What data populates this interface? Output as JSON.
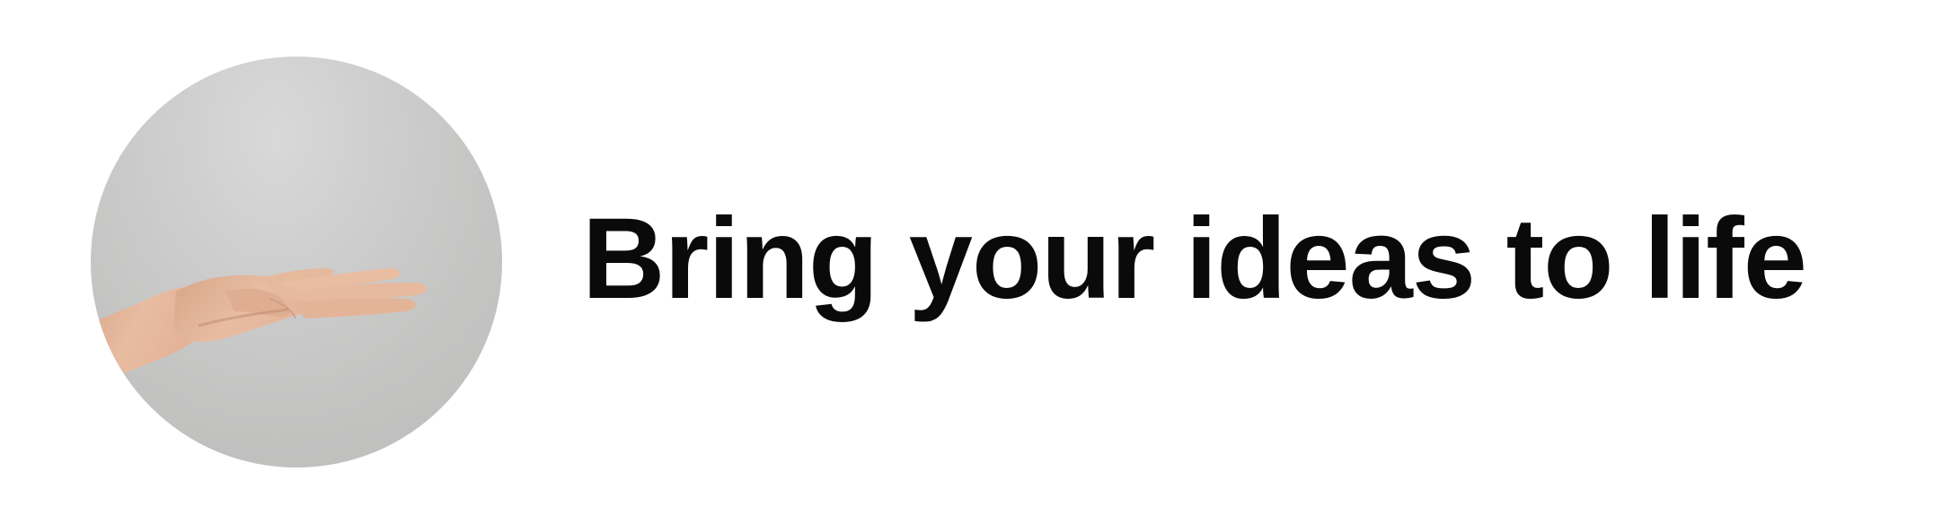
{
  "hero": {
    "headline": "Bring your ideas to life",
    "image": {
      "subject": "open-palm-hand-icon",
      "shape": "circle",
      "colors": {
        "background": "#cbcbca",
        "skin": "#e4b79b",
        "skin_shadow": "#c9967a"
      }
    },
    "colors": {
      "page_background": "#ffffff",
      "text": "#0a0a0a"
    }
  }
}
